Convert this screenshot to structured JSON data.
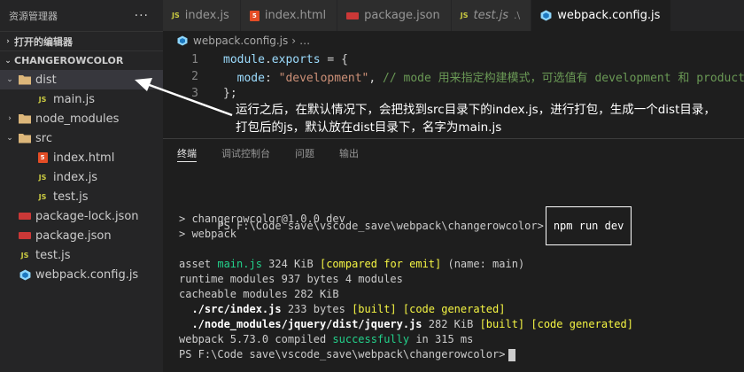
{
  "sidebar": {
    "title": "资源管理器",
    "more": "···",
    "open_editors": "打开的编辑器",
    "project": "CHANGEROWCOLOR",
    "tree": [
      {
        "label": "dist",
        "icon": "folder-icon",
        "indent": 0,
        "twisty": "⌄",
        "selected": true
      },
      {
        "label": "main.js",
        "icon": "js-file-icon",
        "indent": 1
      },
      {
        "label": "node_modules",
        "icon": "folder-icon",
        "indent": 0,
        "twisty": "›"
      },
      {
        "label": "src",
        "icon": "folder-icon",
        "indent": 0,
        "twisty": "⌄"
      },
      {
        "label": "index.html",
        "icon": "html-file-icon",
        "indent": 1
      },
      {
        "label": "index.js",
        "icon": "js-file-icon",
        "indent": 1
      },
      {
        "label": "test.js",
        "icon": "js-file-icon",
        "indent": 1
      },
      {
        "label": "package-lock.json",
        "icon": "json-file-icon",
        "indent": 0
      },
      {
        "label": "package.json",
        "icon": "json-file-icon",
        "indent": 0
      },
      {
        "label": "test.js",
        "icon": "js-file-icon",
        "indent": 0
      },
      {
        "label": "webpack.config.js",
        "icon": "webpack-icon",
        "indent": 0
      }
    ]
  },
  "tabs": [
    {
      "label": "index.js",
      "icon": "js-file-icon"
    },
    {
      "label": "index.html",
      "icon": "html-file-icon"
    },
    {
      "label": "package.json",
      "icon": "json-file-icon"
    },
    {
      "label": "test.js",
      "icon": "js-file-icon",
      "note": ".\\",
      "italic": true
    },
    {
      "label": "webpack.config.js",
      "icon": "webpack-icon",
      "active": true
    }
  ],
  "breadcrumb": {
    "file": "webpack.config.js",
    "rest": "…"
  },
  "editor": {
    "lines": [
      {
        "num": "1",
        "parts": [
          [
            "k-var",
            "module"
          ],
          [
            "k-pun",
            "."
          ],
          [
            "k-var",
            "exports"
          ],
          [
            "k-pun",
            " = {"
          ]
        ]
      },
      {
        "num": "2",
        "parts": [
          [
            "k-pun",
            "  "
          ],
          [
            "k-var",
            "mode"
          ],
          [
            "k-pun",
            ": "
          ],
          [
            "k-str",
            "\"development\""
          ],
          [
            "k-pun",
            ", "
          ],
          [
            "k-com",
            "// mode 用来指定构建模式，可选值有 development 和 production"
          ]
        ]
      },
      {
        "num": "3",
        "parts": [
          [
            "k-pun",
            "};"
          ]
        ]
      }
    ]
  },
  "annotation": {
    "line1": "运行之后，在默认情况下，会把找到src目录下的index.js，进行打包，生成一个dist目录，",
    "line2": "打包后的js，默认放在dist目录下，名字为main.js"
  },
  "panel": {
    "tabs": [
      "终端",
      "调试控制台",
      "问题",
      "输出"
    ],
    "active_tab": 0
  },
  "terminal": {
    "prompt": "PS F:\\Code save\\vscode_save\\webpack\\changerowcolor>",
    "command": "npm run dev",
    "out1": "> changerowcolor@1.0.0 dev",
    "out2": "> webpack",
    "asset_prefix": "asset ",
    "asset_name": "main.js",
    "asset_size": " 324 KiB ",
    "asset_status": "[compared for emit]",
    "asset_suffix": " (name: main)",
    "runtime": "runtime modules 937 bytes 4 modules",
    "cacheable": "cacheable modules 282 KiB",
    "mod1_path": "  ./src/index.js",
    "mod1_size": " 233 bytes ",
    "mod1_tags": "[built] [code generated]",
    "mod2_path": "  ./node_modules/jquery/dist/jquery.js",
    "mod2_size": " 282 KiB ",
    "mod2_tags": "[built] [code generated]",
    "compiled_prefix": "webpack 5.73.0 compiled ",
    "compiled_status": "successfully",
    "compiled_suffix": " in 315 ms",
    "final_prompt": "PS F:\\Code save\\vscode_save\\webpack\\changerowcolor>"
  },
  "colors": {
    "bg": "#1e1e1e",
    "sidebar": "#252526",
    "success_green": "#23d18b",
    "tag_yellow": "#f5f543",
    "js_yellow": "#cbcb41",
    "html_orange": "#e44d26",
    "json_red": "#cb3837"
  }
}
